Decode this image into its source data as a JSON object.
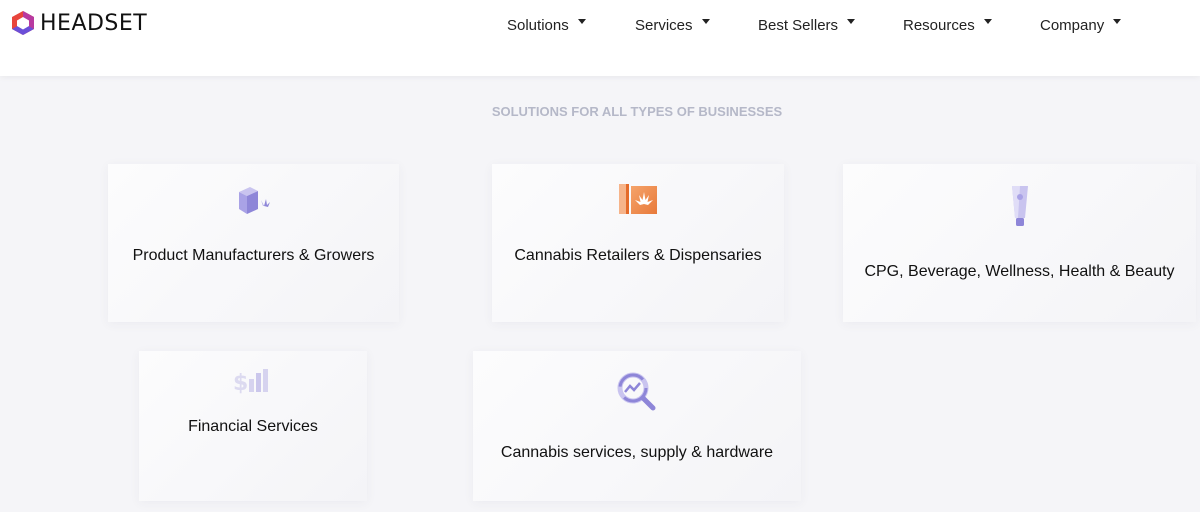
{
  "header": {
    "logo_text": "HEADSET",
    "nav": [
      {
        "label": "Solutions"
      },
      {
        "label": "Services"
      },
      {
        "label": "Best Sellers"
      },
      {
        "label": "Resources"
      },
      {
        "label": "Company"
      }
    ]
  },
  "section": {
    "title": "SOLUTIONS FOR ALL TYPES OF BUSINESSES",
    "cards": [
      {
        "label": "Product Manufacturers & Growers",
        "icon": "box-leaf-icon"
      },
      {
        "label": "Cannabis Retailers & Dispensaries",
        "icon": "store-leaf-icon"
      },
      {
        "label": "CPG, Beverage, Wellness, Health & Beauty",
        "icon": "tube-icon"
      },
      {
        "label": "Financial Services",
        "icon": "dollar-bars-icon"
      },
      {
        "label": "Cannabis services, supply & hardware",
        "icon": "magnifier-chart-icon"
      }
    ]
  },
  "colors": {
    "logo_mark": "#e8453c",
    "logo_mark_secondary": "#6b4fd8",
    "retailer_icon": "#f08c4a",
    "purple_icon": "#8e86d8",
    "section_title": "#b5b8c8"
  }
}
